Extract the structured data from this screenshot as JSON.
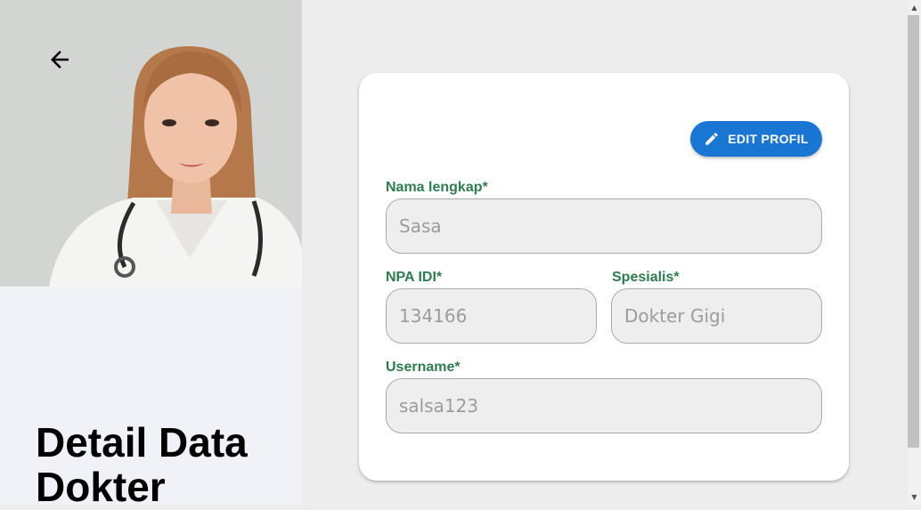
{
  "page": {
    "title": "Detail Data Dokter"
  },
  "photo": {
    "description_icon": "doctor-portrait-image"
  },
  "actions": {
    "edit_label": "EDIT PROFIL"
  },
  "form": {
    "nama_lengkap": {
      "label": "Nama lengkap*",
      "value": "Sasa"
    },
    "npa_idi": {
      "label": "NPA IDI*",
      "value": "134166"
    },
    "spesialis": {
      "label": "Spesialis*",
      "value": "Dokter Gigi"
    },
    "username": {
      "label": "Username*",
      "value": "salsa123"
    }
  },
  "colors": {
    "accent": "#1976d2",
    "label_green": "#2e7d4f",
    "field_bg": "#eeeeee"
  },
  "scrollbar": {
    "up_arrow": "▲",
    "down_arrow": "▼"
  }
}
